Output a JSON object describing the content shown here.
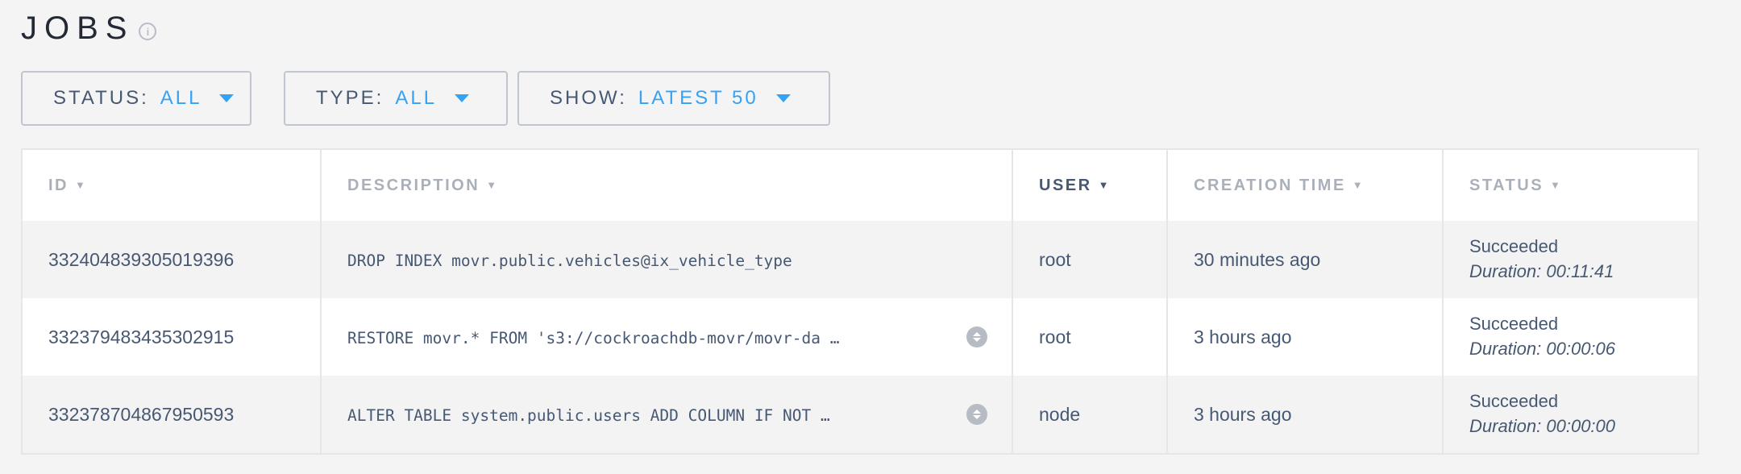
{
  "page": {
    "title": "JOBS",
    "info_icon": "info-icon"
  },
  "filters": {
    "status": {
      "label": "STATUS:",
      "value": "ALL"
    },
    "type": {
      "label": "TYPE:",
      "value": "ALL"
    },
    "show": {
      "label": "SHOW:",
      "value": "LATEST 50"
    }
  },
  "colors": {
    "accent": "#33a3f5",
    "text": "#475872",
    "header_muted": "#aab0ba",
    "border": "#e4e6ea"
  },
  "table": {
    "columns": [
      {
        "label": "ID",
        "arrow": "▼"
      },
      {
        "label": "DESCRIPTION",
        "arrow": "▼"
      },
      {
        "label": "USER",
        "arrow": "▼"
      },
      {
        "label": "CREATION TIME",
        "arrow": "▼"
      },
      {
        "label": "STATUS",
        "arrow": "▼"
      }
    ],
    "rows": [
      {
        "id": "332404839305019396",
        "description": "DROP INDEX movr.public.vehicles@ix_vehicle_type",
        "user": "root",
        "created": "30 minutes ago",
        "status": "Succeeded",
        "duration": "Duration: 00:11:41"
      },
      {
        "id": "332379483435302915",
        "description": "RESTORE movr.* FROM 's3://cockroachdb-movr/movr-da …",
        "user": "root",
        "created": "3 hours ago",
        "status": "Succeeded",
        "duration": "Duration: 00:00:06"
      },
      {
        "id": "332378704867950593",
        "description": "ALTER TABLE system.public.users ADD COLUMN IF NOT …",
        "user": "node",
        "created": "3 hours ago",
        "status": "Succeeded",
        "duration": "Duration: 00:00:00"
      }
    ]
  }
}
